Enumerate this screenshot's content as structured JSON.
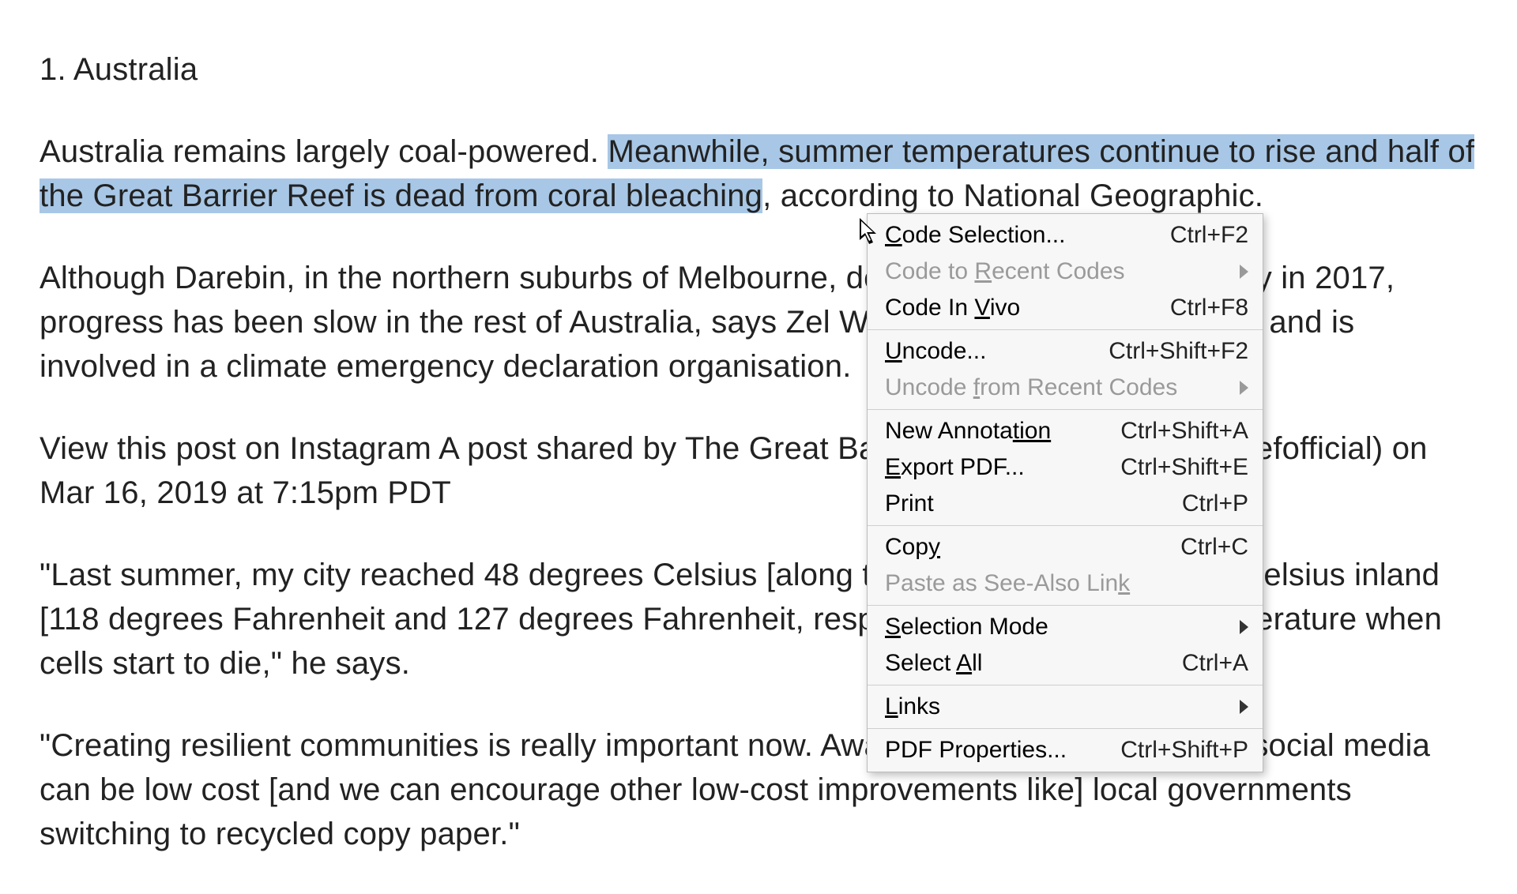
{
  "doc": {
    "heading": "1. Australia",
    "p1_a": "Australia remains largely coal-powered. ",
    "p1_hl": "Meanwhile, summer temperatures continue to rise and half of the Great Barrier Reef is dead from coral bleaching",
    "p1_b": ", according to National Geographic.",
    "p2": "Although Darebin, in the northern suburbs of Melbourne, declared a climate emergency in 2017, progress has been slow in the rest of Australia, says Zel Whiting, who lives in Adelaide and is involved in a climate emergency declaration organisation.",
    "p3": "View this post on Instagram A post shared by The Great Barrier Reef (@greatbarrierreefofficial) on Mar 16, 2019 at 7:15pm PDT",
    "p4": "\"Last summer, my city reached 48 degrees Celsius [along the coast and] 53 degrees Celsius inland [118 degrees Fahrenheit and 127 degrees Fahrenheit, respectively], which is the temperature when cells start to die,\" he says.",
    "p5": "\"Creating resilient communities is really important now. Awareness campaigns across social media can be low cost [and we can encourage other low-cost improvements like] local governments switching to recycled copy paper.\""
  },
  "menu": {
    "code_selection": {
      "pre": "",
      "u": "C",
      "post": "ode Selection...",
      "sc": "Ctrl+F2"
    },
    "code_recent": {
      "pre": "Code to ",
      "u": "R",
      "post": "ecent Codes"
    },
    "code_in_vivo": {
      "pre": "Code In ",
      "u": "V",
      "post": "ivo",
      "sc": "Ctrl+F8"
    },
    "uncode": {
      "pre": "",
      "u": "U",
      "post": "ncode...",
      "sc": "Ctrl+Shift+F2"
    },
    "uncode_recent": {
      "pre": "Uncode ",
      "u": "f",
      "post": "rom Recent Codes"
    },
    "new_annotation": {
      "pre": "New Annota",
      "u": "tion",
      "post": "",
      "sc": "Ctrl+Shift+A"
    },
    "export_pdf": {
      "pre": "",
      "u": "E",
      "post": "xport PDF...",
      "sc": "Ctrl+Shift+E"
    },
    "print": {
      "pre": "Print",
      "u": "",
      "post": "",
      "sc": "Ctrl+P"
    },
    "copy": {
      "pre": "Cop",
      "u": "y",
      "post": "",
      "sc": "Ctrl+C"
    },
    "paste_link": {
      "pre": "Paste as See-Also Lin",
      "u": "k",
      "post": ""
    },
    "selection_mode": {
      "pre": "",
      "u": "S",
      "post": "election Mode"
    },
    "select_all": {
      "pre": "Select ",
      "u": "A",
      "post": "ll",
      "sc": "Ctrl+A"
    },
    "links": {
      "pre": "",
      "u": "L",
      "post": "inks"
    },
    "pdf_props": {
      "pre": "PDF Properties...",
      "u": "",
      "post": "",
      "sc": "Ctrl+Shift+P"
    }
  }
}
